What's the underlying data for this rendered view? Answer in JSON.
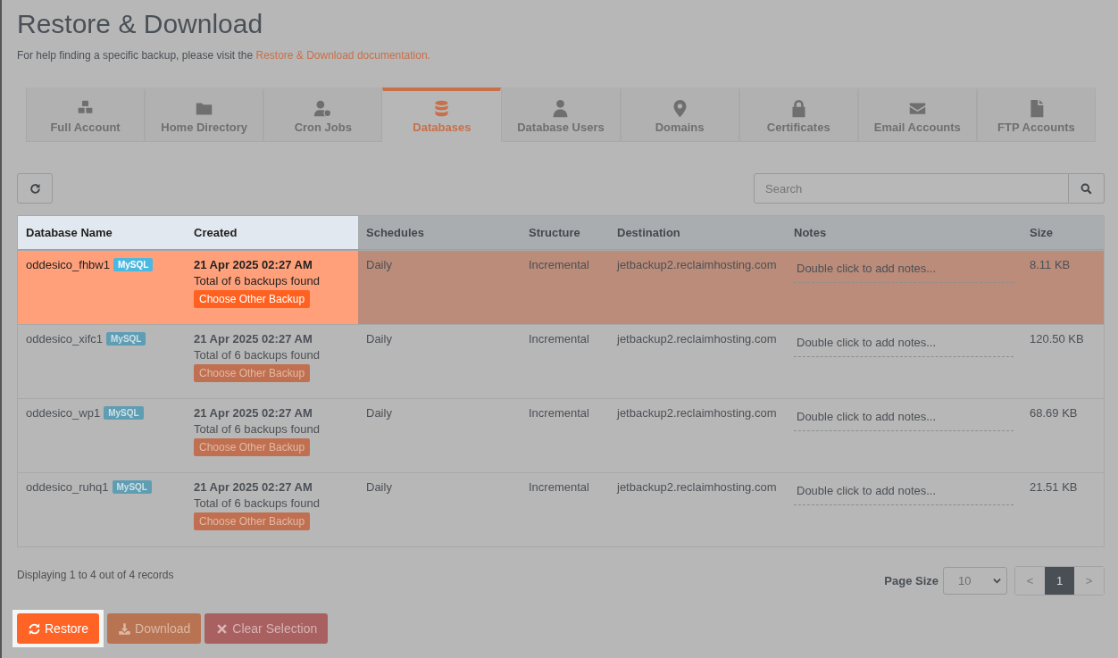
{
  "title": "Restore & Download",
  "intro": {
    "text": "For help finding a specific backup, please visit the",
    "link": "Restore & Download documentation."
  },
  "tabs": [
    {
      "label": "Full Account",
      "kind": "cubes",
      "selected": false
    },
    {
      "label": "Home Directory",
      "kind": "folder",
      "selected": false
    },
    {
      "label": "Cron Jobs",
      "kind": "schedule",
      "selected": false
    },
    {
      "label": "Databases",
      "kind": "database",
      "selected": true
    },
    {
      "label": "Database Users",
      "kind": "user",
      "selected": false
    },
    {
      "label": "Domains",
      "kind": "domain",
      "selected": false
    },
    {
      "label": "Certificates",
      "kind": "certificate",
      "selected": false
    },
    {
      "label": "Email Accounts",
      "kind": "email",
      "selected": false
    },
    {
      "label": "FTP Accounts",
      "kind": "ftp",
      "selected": false
    }
  ],
  "search": {
    "placeholder": "Search"
  },
  "table": {
    "columns": [
      {
        "label": "Database Name",
        "spotlight": true
      },
      {
        "label": "Created",
        "spotlight": true
      },
      {
        "label": "Schedules",
        "spotlight": false
      },
      {
        "label": "Structure",
        "spotlight": false
      },
      {
        "label": "Destination",
        "spotlight": false
      },
      {
        "label": "Notes",
        "spotlight": false
      },
      {
        "label": "Size",
        "spotlight": false
      }
    ],
    "rows": [
      {
        "name": "oddesico_fhbw1",
        "engine": "MySQL",
        "created": "21 Apr 2025 02:27 AM",
        "backups": "Total of 6 backups found",
        "choose": "Choose Other Backup",
        "schedule": "Daily",
        "structure": "Incremental",
        "destination": "jetbackup2.reclaimhosting.com",
        "notes": "Double click to add notes...",
        "size": "8.11 KB",
        "selected": true
      },
      {
        "name": "oddesico_xifc1",
        "engine": "MySQL",
        "created": "21 Apr 2025 02:27 AM",
        "backups": "Total of 6 backups found",
        "choose": "Choose Other Backup",
        "schedule": "Daily",
        "structure": "Incremental",
        "destination": "jetbackup2.reclaimhosting.com",
        "notes": "Double click to add notes...",
        "size": "120.50 KB",
        "selected": false
      },
      {
        "name": "oddesico_wp1",
        "engine": "MySQL",
        "created": "21 Apr 2025 02:27 AM",
        "backups": "Total of 6 backups found",
        "choose": "Choose Other Backup",
        "schedule": "Daily",
        "structure": "Incremental",
        "destination": "jetbackup2.reclaimhosting.com",
        "notes": "Double click to add notes...",
        "size": "68.69 KB",
        "selected": false
      },
      {
        "name": "oddesico_ruhq1",
        "engine": "MySQL",
        "created": "21 Apr 2025 02:27 AM",
        "backups": "Total of 6 backups found",
        "choose": "Choose Other Backup",
        "schedule": "Daily",
        "structure": "Incremental",
        "destination": "jetbackup2.reclaimhosting.com",
        "notes": "Double click to add notes...",
        "size": "21.51 KB",
        "selected": false
      }
    ]
  },
  "footer": {
    "records": "Displaying 1 to 4 out of 4 records",
    "page_size_label": "Page Size",
    "page_size": "10"
  },
  "pagination": [
    {
      "label": "<",
      "selected": false
    },
    {
      "label": "1",
      "selected": true
    },
    {
      "label": ">",
      "selected": false
    }
  ],
  "actions": [
    {
      "label": "Restore",
      "kind": "restore",
      "spotlight": true
    },
    {
      "label": "Download",
      "kind": "download",
      "spotlight": false
    },
    {
      "label": "Clear Selection",
      "kind": "clear",
      "spotlight": false
    }
  ]
}
